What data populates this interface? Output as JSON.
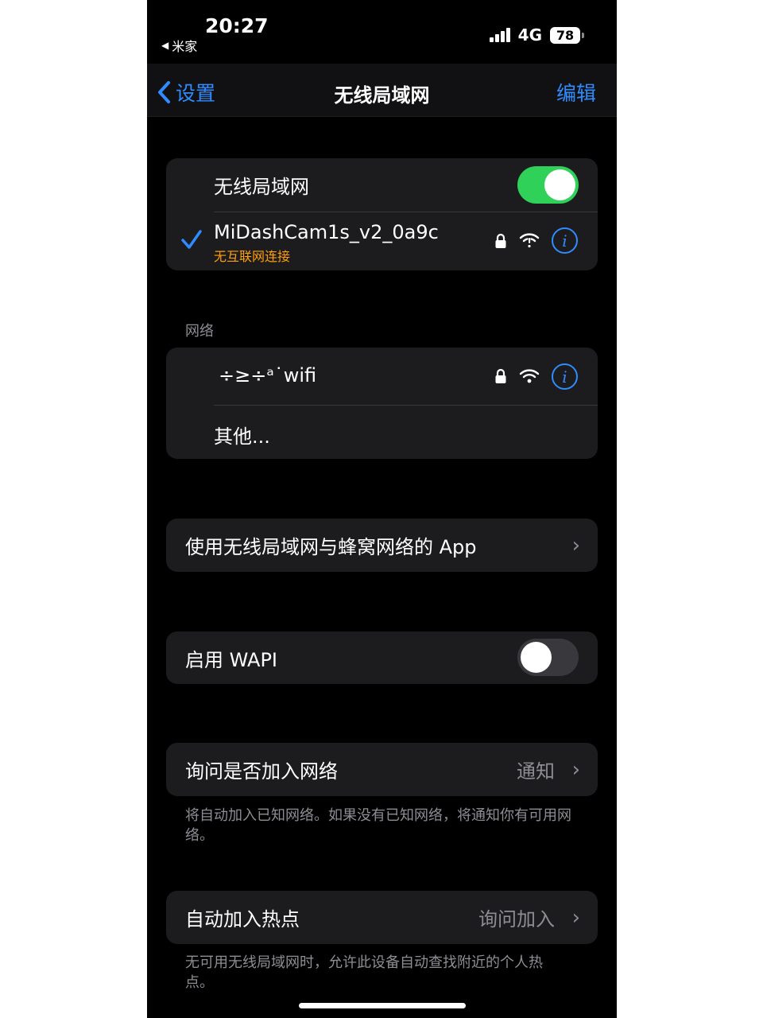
{
  "status_bar": {
    "time": "20:27",
    "back_app": "米家",
    "network": "4G",
    "battery": "78"
  },
  "nav": {
    "back_label": "设置",
    "title": "无线局域网",
    "edit_label": "编辑"
  },
  "wifi_group": {
    "toggle_label": "无线局域网",
    "toggle_on": true,
    "connected_name": "MiDashCam1s_v2_0a9c",
    "connected_status": "无互联网连接"
  },
  "networks": {
    "header": "网络",
    "items": [
      {
        "name": "÷≥÷ᵃ˙wifi"
      }
    ],
    "other_label": "其他..."
  },
  "apps_row": {
    "label": "使用无线局域网与蜂窝网络的 App"
  },
  "wapi_row": {
    "label": "启用 WAPI",
    "toggle_on": false
  },
  "ask_join": {
    "label": "询问是否加入网络",
    "value": "通知",
    "footer": "将自动加入已知网络。如果没有已知网络，将通知你有可用网络。"
  },
  "hotspot": {
    "label": "自动加入热点",
    "value": "询问加入",
    "footer": "无可用无线局域网时，允许此设备自动查找附近的个人热点。"
  },
  "colors": {
    "accent": "#2f8cff",
    "toggle_on": "#30d158",
    "warning": "#ff9f0a",
    "cell_bg": "#1c1c1e"
  }
}
